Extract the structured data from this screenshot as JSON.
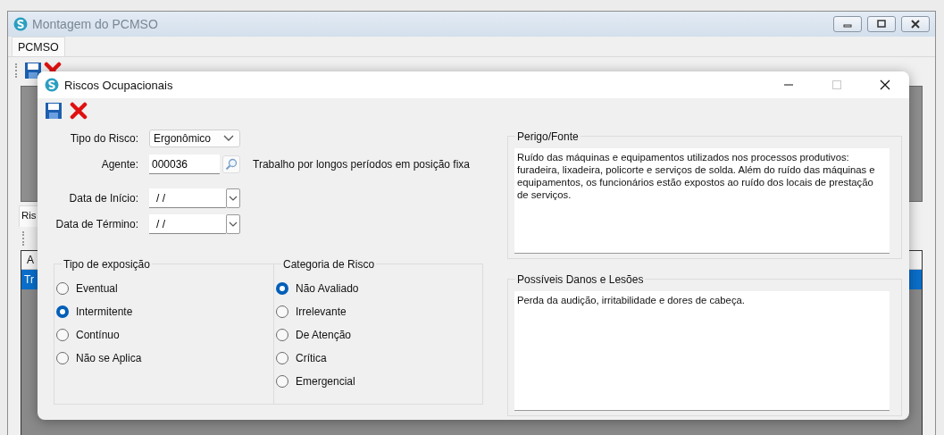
{
  "background_window": {
    "title": "Montagem do PCMSO",
    "tabs": [
      {
        "label": "PCMSO",
        "selected": true
      }
    ],
    "lower_tab": "Ris",
    "grid": {
      "column_1": "A",
      "rows": [
        {
          "cell_1": "Tr",
          "selected": true
        }
      ]
    }
  },
  "dialog": {
    "title": "Riscos Ocupacionais",
    "tipo_do_risco": {
      "label": "Tipo do Risco:",
      "value": "Ergonômico"
    },
    "agente": {
      "label": "Agente:",
      "value": "000036",
      "description": "Trabalho por longos períodos em posição fixa"
    },
    "data_inicio": {
      "label": "Data de Início:",
      "value": "/ /"
    },
    "data_termino": {
      "label": "Data de Término:",
      "value": "/ /"
    },
    "option_groups": [
      {
        "title": "Tipo de exposição",
        "options": [
          {
            "label": "Eventual",
            "selected": false
          },
          {
            "label": "Intermitente",
            "selected": true
          },
          {
            "label": "Contínuo",
            "selected": false
          },
          {
            "label": "Não se Aplica",
            "selected": false
          }
        ]
      },
      {
        "title": "Categoria de Risco",
        "options": [
          {
            "label": "Não Avaliado",
            "selected": true
          },
          {
            "label": "Irrelevante",
            "selected": false
          },
          {
            "label": "De Atenção",
            "selected": false
          },
          {
            "label": "Crítica",
            "selected": false
          },
          {
            "label": "Emergencial",
            "selected": false
          }
        ]
      }
    ],
    "text_panels": [
      {
        "title": "Perigo/Fonte",
        "text": "Ruído das máquinas e equipamentos utilizados nos processos produtivos: furadeira, lixadeira, policorte e serviços de solda. Além do ruído das máquinas e equipamentos, os funcionários estão expostos ao ruído dos locais de prestação de serviços."
      },
      {
        "title": "Possíveis Danos e Lesões",
        "text": "Perda da audição, irritabilidade e dores de cabeça."
      }
    ]
  }
}
